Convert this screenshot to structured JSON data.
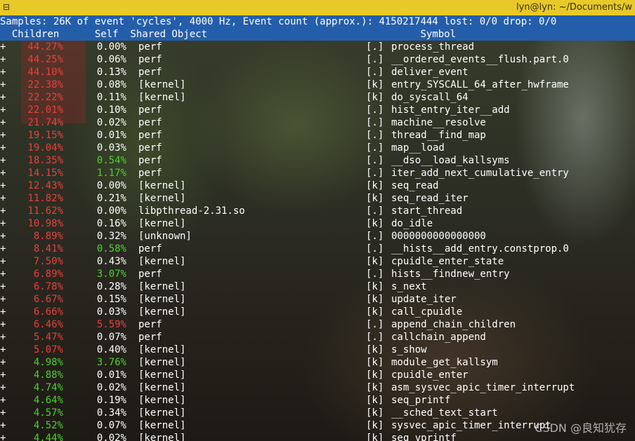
{
  "window": {
    "title": "lyn@lyn: ~/Documents/w",
    "menu_glyph": "⊟"
  },
  "header": {
    "summary": "Samples: 26K of event 'cycles', 4000 Hz, Event count (approx.): 4150217444 lost: 0/0 drop: 0/0",
    "columns": "  Children      Self  Shared Object                                    Symbol"
  },
  "colors": {
    "red": "#e8423c",
    "green": "#4fd12f",
    "white": "#ffffff",
    "header_bg": "#245eaa",
    "titlebar_bg": "#e8c92a"
  },
  "rows": [
    {
      "plus": "+",
      "children": "44.27%",
      "children_color": "red",
      "self": "0.00%",
      "self_color": "white",
      "object": "perf",
      "level": "[.]",
      "symbol": "process_thread"
    },
    {
      "plus": "+",
      "children": "44.25%",
      "children_color": "red",
      "self": "0.06%",
      "self_color": "white",
      "object": "perf",
      "level": "[.]",
      "symbol": "__ordered_events__flush.part.0"
    },
    {
      "plus": "+",
      "children": "44.10%",
      "children_color": "red",
      "self": "0.13%",
      "self_color": "white",
      "object": "perf",
      "level": "[.]",
      "symbol": "deliver_event"
    },
    {
      "plus": "+",
      "children": "22.38%",
      "children_color": "red",
      "self": "0.08%",
      "self_color": "white",
      "object": "[kernel]",
      "level": "[k]",
      "symbol": "entry_SYSCALL_64_after_hwframe"
    },
    {
      "plus": "+",
      "children": "22.22%",
      "children_color": "red",
      "self": "0.11%",
      "self_color": "white",
      "object": "[kernel]",
      "level": "[k]",
      "symbol": "do_syscall_64"
    },
    {
      "plus": "+",
      "children": "22.01%",
      "children_color": "red",
      "self": "0.10%",
      "self_color": "white",
      "object": "perf",
      "level": "[.]",
      "symbol": "hist_entry_iter__add"
    },
    {
      "plus": "+",
      "children": "21.74%",
      "children_color": "red",
      "self": "0.02%",
      "self_color": "white",
      "object": "perf",
      "level": "[.]",
      "symbol": "machine__resolve"
    },
    {
      "plus": "+",
      "children": "19.15%",
      "children_color": "red",
      "self": "0.01%",
      "self_color": "white",
      "object": "perf",
      "level": "[.]",
      "symbol": "thread__find_map"
    },
    {
      "plus": "+",
      "children": "19.04%",
      "children_color": "red",
      "self": "0.03%",
      "self_color": "white",
      "object": "perf",
      "level": "[.]",
      "symbol": "map__load"
    },
    {
      "plus": "+",
      "children": "18.35%",
      "children_color": "red",
      "self": "0.54%",
      "self_color": "green",
      "object": "perf",
      "level": "[.]",
      "symbol": "__dso__load_kallsyms"
    },
    {
      "plus": "+",
      "children": "14.15%",
      "children_color": "red",
      "self": "1.17%",
      "self_color": "green",
      "object": "perf",
      "level": "[.]",
      "symbol": "iter_add_next_cumulative_entry"
    },
    {
      "plus": "+",
      "children": "12.43%",
      "children_color": "red",
      "self": "0.00%",
      "self_color": "white",
      "object": "[kernel]",
      "level": "[k]",
      "symbol": "seq_read"
    },
    {
      "plus": "+",
      "children": "11.82%",
      "children_color": "red",
      "self": "0.21%",
      "self_color": "white",
      "object": "[kernel]",
      "level": "[k]",
      "symbol": "seq_read_iter"
    },
    {
      "plus": "+",
      "children": "11.62%",
      "children_color": "red",
      "self": "0.00%",
      "self_color": "white",
      "object": "libpthread-2.31.so",
      "level": "[.]",
      "symbol": "start_thread"
    },
    {
      "plus": "+",
      "children": "10.98%",
      "children_color": "red",
      "self": "0.16%",
      "self_color": "white",
      "object": "[kernel]",
      "level": "[k]",
      "symbol": "do_idle"
    },
    {
      "plus": "+",
      "children": "8.89%",
      "children_color": "red",
      "self": "0.32%",
      "self_color": "white",
      "object": "[unknown]",
      "level": "[.]",
      "symbol": "0000000000000000"
    },
    {
      "plus": "+",
      "children": "8.41%",
      "children_color": "red",
      "self": "0.58%",
      "self_color": "green",
      "object": "perf",
      "level": "[.]",
      "symbol": "__hists__add_entry.constprop.0"
    },
    {
      "plus": "+",
      "children": "7.50%",
      "children_color": "red",
      "self": "0.43%",
      "self_color": "white",
      "object": "[kernel]",
      "level": "[k]",
      "symbol": "cpuidle_enter_state"
    },
    {
      "plus": "+",
      "children": "6.89%",
      "children_color": "red",
      "self": "3.07%",
      "self_color": "green",
      "object": "perf",
      "level": "[.]",
      "symbol": "hists__findnew_entry"
    },
    {
      "plus": "+",
      "children": "6.78%",
      "children_color": "red",
      "self": "0.28%",
      "self_color": "white",
      "object": "[kernel]",
      "level": "[k]",
      "symbol": "s_next"
    },
    {
      "plus": "+",
      "children": "6.67%",
      "children_color": "red",
      "self": "0.15%",
      "self_color": "white",
      "object": "[kernel]",
      "level": "[k]",
      "symbol": "update_iter"
    },
    {
      "plus": "+",
      "children": "6.66%",
      "children_color": "red",
      "self": "0.03%",
      "self_color": "white",
      "object": "[kernel]",
      "level": "[k]",
      "symbol": "call_cpuidle"
    },
    {
      "plus": "+",
      "children": "6.46%",
      "children_color": "red",
      "self": "5.59%",
      "self_color": "red",
      "object": "perf",
      "level": "[.]",
      "symbol": "append_chain_children"
    },
    {
      "plus": "+",
      "children": "5.47%",
      "children_color": "red",
      "self": "0.07%",
      "self_color": "white",
      "object": "perf",
      "level": "[.]",
      "symbol": "callchain_append"
    },
    {
      "plus": "+",
      "children": "5.07%",
      "children_color": "red",
      "self": "0.40%",
      "self_color": "white",
      "object": "[kernel]",
      "level": "[k]",
      "symbol": "s_show"
    },
    {
      "plus": "+",
      "children": "4.98%",
      "children_color": "green",
      "self": "3.76%",
      "self_color": "green",
      "object": "[kernel]",
      "level": "[k]",
      "symbol": "module_get_kallsym"
    },
    {
      "plus": "+",
      "children": "4.88%",
      "children_color": "green",
      "self": "0.01%",
      "self_color": "white",
      "object": "[kernel]",
      "level": "[k]",
      "symbol": "cpuidle_enter"
    },
    {
      "plus": "+",
      "children": "4.74%",
      "children_color": "green",
      "self": "0.02%",
      "self_color": "white",
      "object": "[kernel]",
      "level": "[k]",
      "symbol": "asm_sysvec_apic_timer_interrupt"
    },
    {
      "plus": "+",
      "children": "4.64%",
      "children_color": "green",
      "self": "0.19%",
      "self_color": "white",
      "object": "[kernel]",
      "level": "[k]",
      "symbol": "seq_printf"
    },
    {
      "plus": "+",
      "children": "4.57%",
      "children_color": "green",
      "self": "0.34%",
      "self_color": "white",
      "object": "[kernel]",
      "level": "[k]",
      "symbol": "__sched_text_start"
    },
    {
      "plus": "+",
      "children": "4.52%",
      "children_color": "green",
      "self": "0.07%",
      "self_color": "white",
      "object": "[kernel]",
      "level": "[k]",
      "symbol": "sysvec_apic_timer_interrupt"
    },
    {
      "plus": "+",
      "children": "4.44%",
      "children_color": "green",
      "self": "0.02%",
      "self_color": "white",
      "object": "[kernel]",
      "level": "[k]",
      "symbol": "seq_vprintf"
    }
  ],
  "watermark": "CSDN @良知犹存"
}
